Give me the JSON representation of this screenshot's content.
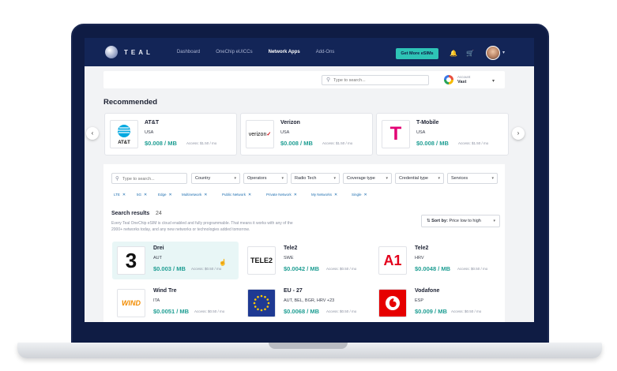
{
  "nav": {
    "logo_text": "TEAL",
    "links": [
      "Dashboard",
      "OneChip eUICCs",
      "Network Apps",
      "Add-Ons"
    ],
    "cta_label": "Get More eSIMs"
  },
  "search": {
    "placeholder": "Type to search..."
  },
  "account": {
    "label": "Account",
    "name": "Vast"
  },
  "recommended": {
    "title": "Recommended",
    "cards": [
      {
        "name": "AT&T",
        "country": "USA",
        "price": "$0.008 / MB",
        "access": "Access: $1.50 / mo",
        "logo_text": "AT&T"
      },
      {
        "name": "Verizon",
        "country": "USA",
        "price": "$0.008 / MB",
        "access": "Access: $1.50 / mo",
        "logo_text": "verizon"
      },
      {
        "name": "T-Mobile",
        "country": "USA",
        "price": "$0.008 / MB",
        "access": "Access: $1.50 / mo",
        "logo_text": "T"
      }
    ]
  },
  "filters": {
    "search_placeholder": "Type to search...",
    "selects": [
      "Country",
      "Operators",
      "Radio Tech",
      "Coverage type",
      "Credential type",
      "Services"
    ],
    "chips": [
      "LTE",
      "5G",
      "Edge",
      "Multinetwork",
      "Public Network",
      "Private Network",
      "My Networks",
      "Single"
    ]
  },
  "results": {
    "title": "Search results",
    "count": "24",
    "desc_line1": "Every Teal OneChip eSIM is cloud enabled and fully programmable. That means it works with any of the",
    "desc_line2": "2000+ networks today, and any new networks or technologies added tomorrow.",
    "sort_label": "Sort by:",
    "sort_value": "Price low to high",
    "items": [
      {
        "name": "Drei",
        "country": "AUT",
        "price": "$0.003 / MB",
        "access": "Access: $0.50 / mo",
        "logo_text": "3"
      },
      {
        "name": "Tele2",
        "country": "SWE",
        "price": "$0.0042 / MB",
        "access": "Access: $0.50 / mo",
        "logo_text": "TELE2"
      },
      {
        "name": "Tele2",
        "country": "HRV",
        "price": "$0.0048 / MB",
        "access": "Access: $0.50 / mo",
        "logo_text": "A1"
      },
      {
        "name": "Wind Tre",
        "country": "ITA",
        "price": "$0.0051 / MB",
        "access": "Access: $0.50 / mo",
        "logo_text": "WIND"
      },
      {
        "name": "EU - 27",
        "country": "AUT, BEL, BGR, HRV +23",
        "price": "$0.0068 / MB",
        "access": "Access: $0.50 / mo",
        "logo_text": ""
      },
      {
        "name": "Vodafone",
        "country": "ESP",
        "price": "$0.009 / MB",
        "access": "Access: $0.50 / mo",
        "logo_text": ""
      }
    ]
  },
  "colors": {
    "nav_bg": "#132557",
    "accent": "#2ec4b6",
    "price": "#1f9e93",
    "chip": "#1f6fb0"
  }
}
